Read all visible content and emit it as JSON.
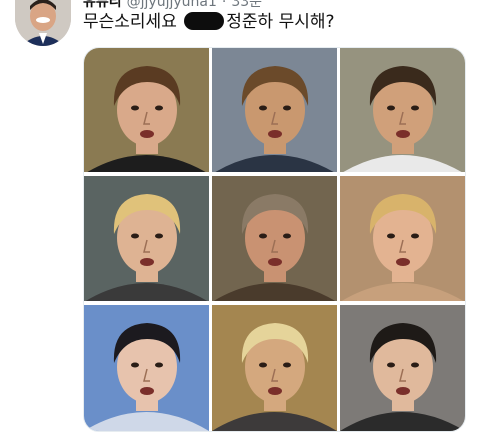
{
  "tweet": {
    "display_name": "유뮤리",
    "handle": "@jjyujjyuna1",
    "separator": "·",
    "time": "33분",
    "text_before": "무슨소리세요",
    "text_after": "정준하 무시해?"
  },
  "media": {
    "tiles": [
      {
        "bg": "#8a7a52",
        "skin": "#d9a98a",
        "hair": "#5a3b22",
        "shirt": "#1d1d1d"
      },
      {
        "bg": "#7c8795",
        "skin": "#c9986f",
        "hair": "#6b4a2a",
        "shirt": "#2a3444"
      },
      {
        "bg": "#96937f",
        "skin": "#d0a07a",
        "hair": "#3a2a1c",
        "shirt": "#e9e9e9"
      },
      {
        "bg": "#5a6462",
        "skin": "#deb393",
        "hair": "#e0c27a",
        "shirt": "#3a3a3a"
      },
      {
        "bg": "#72654f",
        "skin": "#c99272",
        "hair": "#8a7a66",
        "shirt": "#4a3b2c"
      },
      {
        "bg": "#b3916f",
        "skin": "#e3b391",
        "hair": "#d8b36b",
        "shirt": "#c7a07c"
      },
      {
        "bg": "#6a8fc9",
        "skin": "#e7c3ad",
        "hair": "#1c1a1f",
        "shirt": "#cfd8e8"
      },
      {
        "bg": "#a48650",
        "skin": "#d4a87e",
        "hair": "#e5d49a",
        "shirt": "#3d3a3a"
      },
      {
        "bg": "#7d7a77",
        "skin": "#e0b99c",
        "hair": "#1e1a17",
        "shirt": "#2b2b2b"
      }
    ]
  },
  "colors": {
    "text": "#111111",
    "secondary_text": "#6e767d",
    "redaction": "#0d0d0d"
  }
}
